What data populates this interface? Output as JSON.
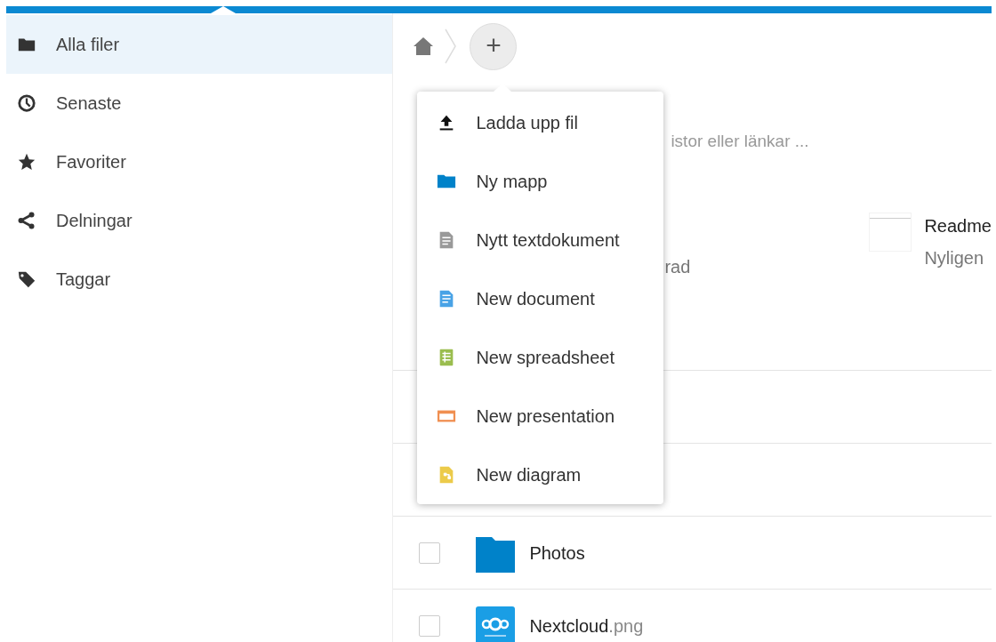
{
  "sidebar": {
    "items": [
      {
        "label": "Alla filer",
        "kind": "folder",
        "selected": true
      },
      {
        "label": "Senaste",
        "kind": "clock",
        "selected": false
      },
      {
        "label": "Favoriter",
        "kind": "star",
        "selected": false
      },
      {
        "label": "Delningar",
        "kind": "share",
        "selected": false
      },
      {
        "label": "Taggar",
        "kind": "tag",
        "selected": false
      }
    ]
  },
  "breadcrumb": {
    "new_button": "+"
  },
  "new_menu": {
    "items": [
      {
        "kind": "upload",
        "label": "Ladda upp fil"
      },
      {
        "kind": "folder",
        "label": "Ny mapp"
      },
      {
        "kind": "text",
        "label": "Nytt textdokument"
      },
      {
        "kind": "document",
        "label": "New document"
      },
      {
        "kind": "spreadsheet",
        "label": "New spreadsheet"
      },
      {
        "kind": "presentation",
        "label": "New presentation"
      },
      {
        "kind": "diagram",
        "label": "New diagram"
      }
    ]
  },
  "comment_field": {
    "placeholder": "istor eller länkar ..."
  },
  "recommendations": [
    {
      "subtitle": "rad"
    },
    {
      "title": "Readme",
      "subtitle": "Nyligen"
    }
  ],
  "files": [
    {
      "kind": "folder",
      "name": "Photos",
      "checked": false
    },
    {
      "kind": "image",
      "name": "Nextcloud",
      "extension": ".png",
      "checked": false
    }
  ]
}
